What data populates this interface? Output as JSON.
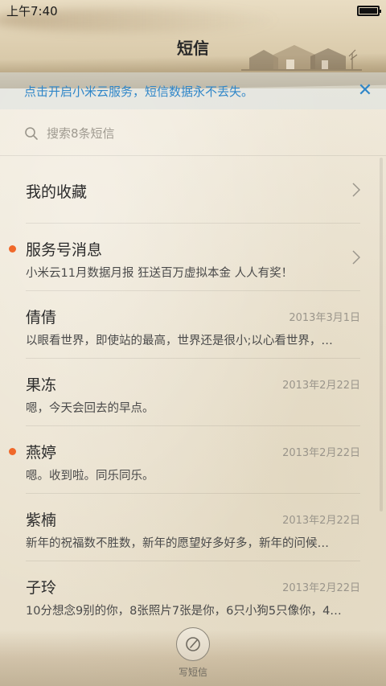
{
  "status_bar": {
    "time": "上午7:40"
  },
  "header": {
    "title": "短信"
  },
  "banner": {
    "text": "点击开启小米云服务，短信数据永不丢失。",
    "close_label": "✕",
    "color": "#2f86c8"
  },
  "search": {
    "placeholder": "搜索8条短信"
  },
  "accent": {
    "unread_dot": "#f0682a"
  },
  "conversations": [
    {
      "name": "我的收藏",
      "preview": "",
      "date": "",
      "unread": false,
      "chevron": true
    },
    {
      "name": "服务号消息",
      "preview": "小米云11月数据月报 狂送百万虚拟本金 人人有奖！",
      "date": "",
      "unread": true,
      "chevron": true
    },
    {
      "name": "倩倩",
      "preview": "以眼看世界，即使站的最高，世界还是很小;以心看世界，…",
      "date": "2013年3月1日",
      "unread": false
    },
    {
      "name": "果冻",
      "preview": "嗯，今天会回去的早点。",
      "date": "2013年2月22日",
      "unread": false
    },
    {
      "name": "燕婷",
      "preview": "嗯。收到啦。同乐同乐。",
      "date": "2013年2月22日",
      "unread": true
    },
    {
      "name": "紫楠",
      "preview": "新年的祝福数不胜数，新年的愿望好多好多，新年的问候…",
      "date": "2013年2月22日",
      "unread": false
    },
    {
      "name": "子玲",
      "preview": "10分想念9别的你，8张照片7张是你，6只小狗5只像你，4…",
      "date": "2013年2月22日",
      "unread": false
    }
  ],
  "compose": {
    "label": "写短信",
    "icon": "compose-icon"
  }
}
